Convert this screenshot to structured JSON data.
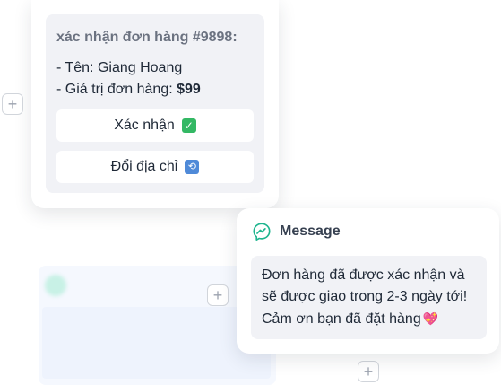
{
  "order_card": {
    "title": "xác nhận đơn hàng #9898:",
    "name_line": "- Tên: Giang Hoang",
    "value_prefix": "- Giá trị đơn hàng: ",
    "value_amount": "$99",
    "confirm_button": {
      "label": "Xác nhận",
      "emoji": "✓",
      "icon": "check-mark-emoji"
    },
    "change_address_button": {
      "label": "Đổi địa chỉ",
      "emoji": "⟲",
      "icon": "repeat-emoji"
    }
  },
  "message_card": {
    "header": "Message",
    "icon": "messenger-icon",
    "accent_color": "#1fb58f",
    "body": "Đơn hàng đã được xác nhận và sẽ được giao trong 2-3 ngày tới! Cảm ơn bạn đã đặt hàng",
    "emoji": "💖"
  },
  "add_buttons": [
    {
      "label": "+"
    },
    {
      "label": "+"
    },
    {
      "label": "+"
    }
  ]
}
